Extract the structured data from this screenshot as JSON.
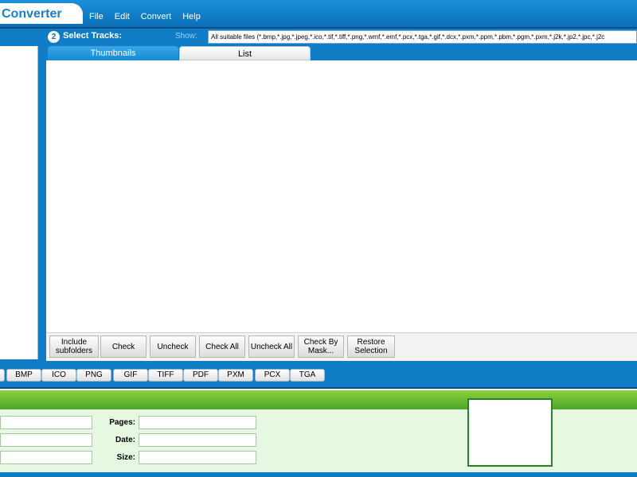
{
  "app": {
    "title": "Converter"
  },
  "menu": {
    "items": [
      "File",
      "Edit",
      "Convert",
      "Help"
    ]
  },
  "tracks": {
    "step": "2",
    "title": "Select Tracks:",
    "show_label": "Show:",
    "show_value": "All suitable files (*.bmp,*.jpg,*.jpeg,*.ico,*.tif,*.tiff,*.png,*.wmf,*.emf,*.pcx,*.tga,*.gif,*.dcx,*.pxm,*.ppm,*.pbm,*.pgm,*.pxm,*.j2k,*.jp2,*.jpc,*.j2c"
  },
  "tabs": [
    {
      "label": "Thumbnails",
      "active": true
    },
    {
      "label": "List",
      "active": false
    }
  ],
  "buttons": [
    "Include\nsubfolders",
    "Check",
    "Uncheck",
    "Check All",
    "Uncheck All",
    "Check By\nMask...",
    "Restore\nSelection"
  ],
  "formats": [
    "BMP",
    "ICO",
    "PNG",
    "GIF",
    "TIFF",
    "PDF",
    "PXM",
    "PCX",
    "TGA"
  ],
  "info": {
    "pages_label": "Pages:",
    "date_label": "Date:",
    "size_label": "Size:"
  },
  "colors": {
    "primary": "#0f7cc5",
    "green": "#4ea82b",
    "info_bg": "#e6f7e2"
  }
}
